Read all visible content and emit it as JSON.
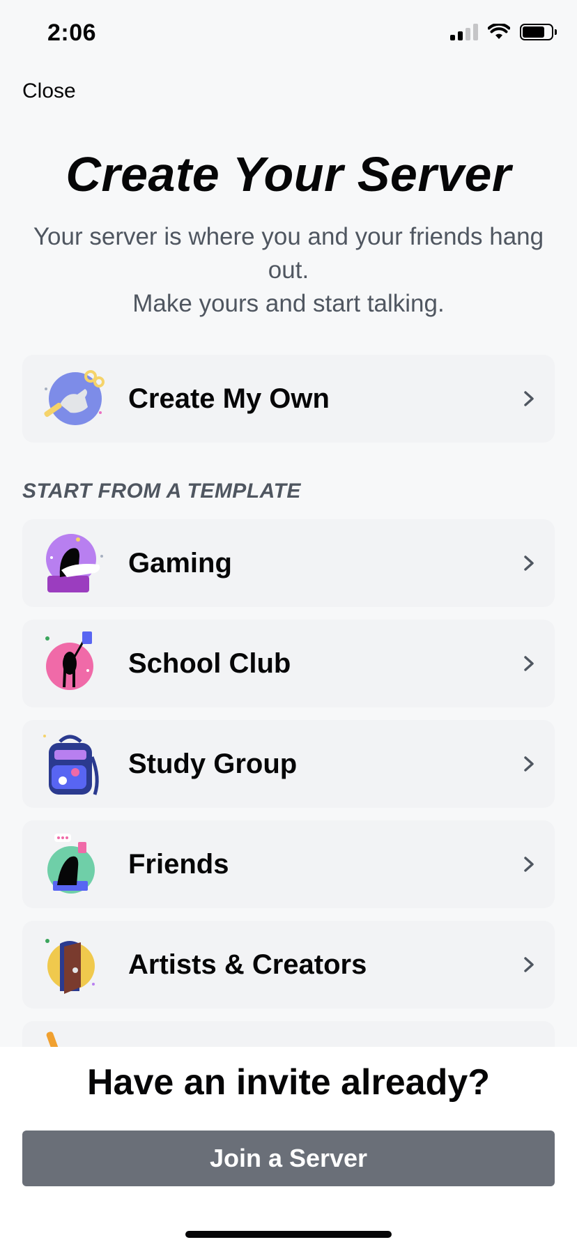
{
  "status_bar": {
    "time": "2:06"
  },
  "header": {
    "close_label": "Close"
  },
  "main": {
    "title": "Create Your Server",
    "subtitle_line1": "Your server is where you and your friends hang out.",
    "subtitle_line2": "Make yours and start talking.",
    "create_own_label": "Create My Own",
    "template_section_label": "START FROM A TEMPLATE",
    "templates": [
      {
        "label": "Gaming",
        "icon": "gaming-illustration-icon"
      },
      {
        "label": "School Club",
        "icon": "school-club-illustration-icon"
      },
      {
        "label": "Study Group",
        "icon": "study-group-illustration-icon"
      },
      {
        "label": "Friends",
        "icon": "friends-illustration-icon"
      },
      {
        "label": "Artists & Creators",
        "icon": "artists-illustration-icon"
      }
    ]
  },
  "footer": {
    "invite_question": "Have an invite already?",
    "join_button_label": "Join a Server"
  },
  "colors": {
    "background": "#f7f8f9",
    "card": "#f2f3f5",
    "join_button": "#6a6f78",
    "muted_text": "#4f5660"
  }
}
